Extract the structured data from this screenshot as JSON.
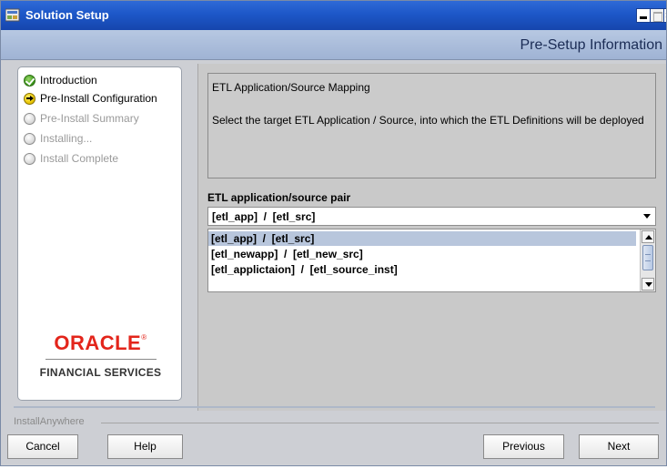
{
  "window": {
    "title": "Solution Setup",
    "close_glyph": "×"
  },
  "header": {
    "step_title": "Pre-Setup Information"
  },
  "steps": [
    {
      "label": "Introduction",
      "state": "done"
    },
    {
      "label": "Pre-Install Configuration",
      "state": "current"
    },
    {
      "label": "Pre-Install Summary",
      "state": "pending"
    },
    {
      "label": "Installing...",
      "state": "pending"
    },
    {
      "label": "Install Complete",
      "state": "pending"
    }
  ],
  "logo": {
    "brand": "ORACLE",
    "registered": "®",
    "subtitle": "FINANCIAL SERVICES"
  },
  "info": {
    "heading": "ETL Application/Source Mapping",
    "description": "Select the target ETL Application / Source, into which the ETL Definitions will be deployed"
  },
  "pair": {
    "label": "ETL application/source pair",
    "selected": "[etl_app]  /  [etl_src]",
    "options": [
      "[etl_app]  /  [etl_src]",
      "[etl_newapp]  /  [etl_new_src]",
      "[etl_applictaion]  /  [etl_source_inst]"
    ]
  },
  "footer": {
    "brand": "InstallAnywhere",
    "cancel_label": "Cancel",
    "help_label": "Help",
    "previous_label": "Previous",
    "next_label": "Next"
  },
  "colors": {
    "title_bar": "#1d57c8",
    "header_bg": "#a9bad8",
    "selection": "#b8c6dc",
    "oracle_red": "#e3251b"
  },
  "icons": [
    "app-icon",
    "minimize-icon",
    "maximize-icon",
    "close-icon",
    "check-icon",
    "arrow-right-icon",
    "radio-empty-icon",
    "dropdown-arrow-icon",
    "scroll-up-icon",
    "scroll-down-icon"
  ]
}
